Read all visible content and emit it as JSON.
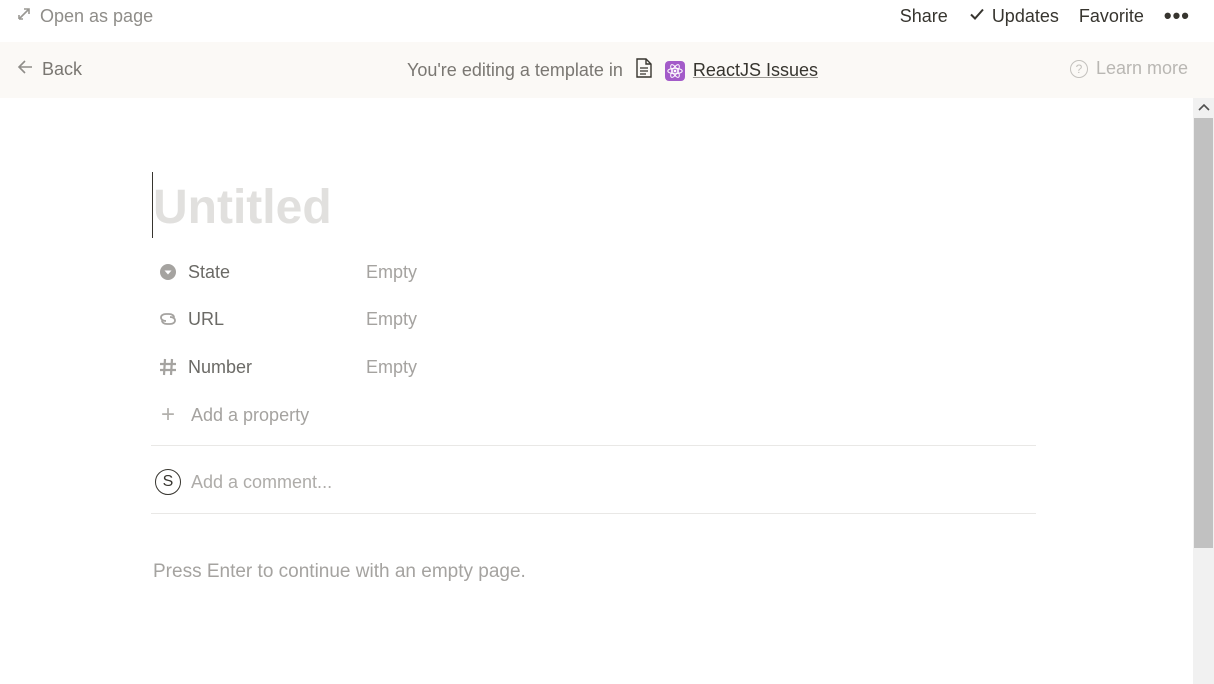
{
  "topbar": {
    "open_as_page": "Open as page",
    "share": "Share",
    "updates": "Updates",
    "favorite": "Favorite",
    "more": "•••"
  },
  "banner": {
    "back": "Back",
    "editing_text": "You're editing a template in",
    "database_name": "ReactJS Issues",
    "learn_more": "Learn more"
  },
  "page": {
    "title_placeholder": "Untitled",
    "properties": [
      {
        "name": "State",
        "value": "Empty",
        "icon": "select-icon"
      },
      {
        "name": "URL",
        "value": "Empty",
        "icon": "link-icon"
      },
      {
        "name": "Number",
        "value": "Empty",
        "icon": "hash-icon"
      }
    ],
    "add_property": "Add a property",
    "avatar_initial": "S",
    "comment_placeholder": "Add a comment...",
    "empty_hint": "Press Enter to continue with an empty page."
  },
  "colors": {
    "banner_bg": "#fbf9f6",
    "react_badge": "#a35bc9",
    "text": "#37352f",
    "muted": "#a5a3a0"
  }
}
